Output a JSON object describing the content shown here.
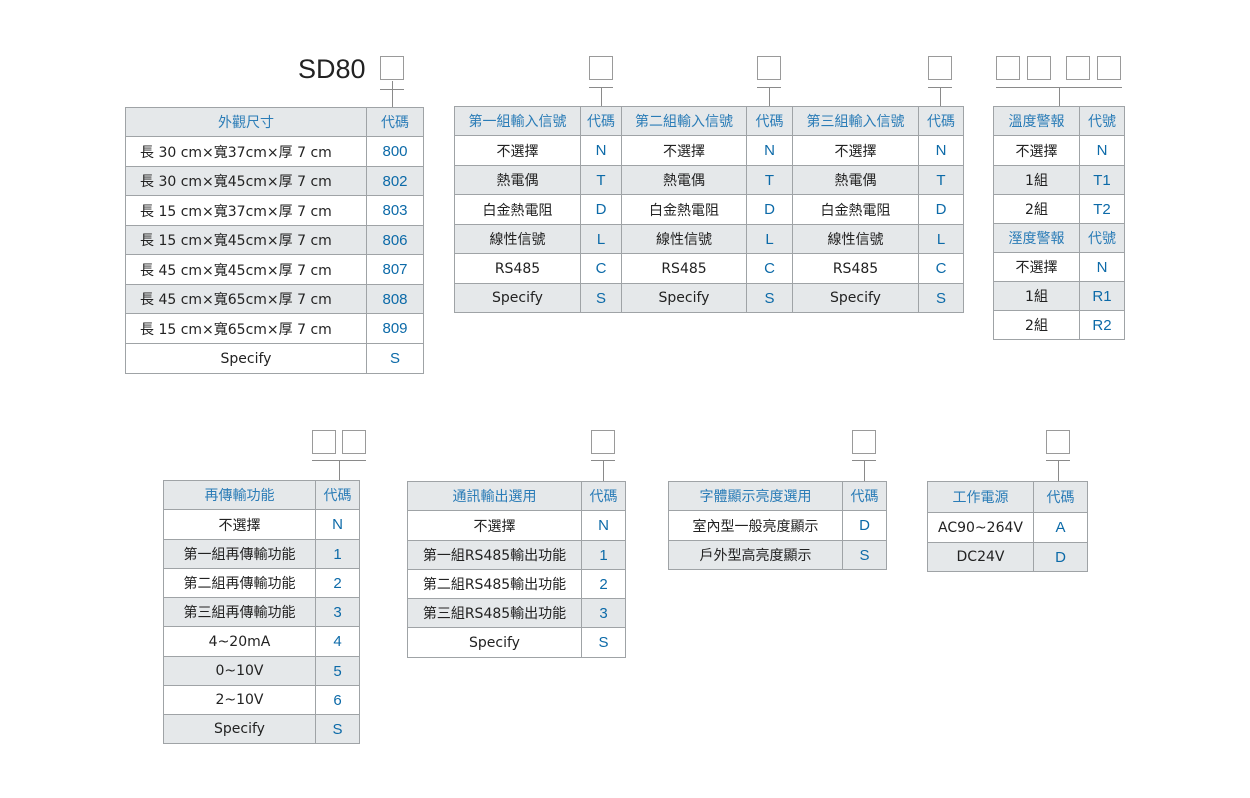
{
  "model": "SD80",
  "size_table": {
    "header": {
      "name": "外觀尺寸",
      "code": "代碼"
    },
    "rows": [
      {
        "name": "長 30 cm×寬37cm×厚 7 cm",
        "code": "800"
      },
      {
        "name": "長 30 cm×寬45cm×厚 7 cm",
        "code": "802"
      },
      {
        "name": "長 15 cm×寬37cm×厚 7 cm",
        "code": "803"
      },
      {
        "name": "長 15 cm×寬45cm×厚 7 cm",
        "code": "806"
      },
      {
        "name": "長 45 cm×寬45cm×厚 7 cm",
        "code": "807"
      },
      {
        "name": "長 45 cm×寬65cm×厚 7 cm",
        "code": "808"
      },
      {
        "name": "長 15 cm×寬65cm×厚 7 cm",
        "code": "809"
      },
      {
        "name": "Specify",
        "code": "S"
      }
    ]
  },
  "input_table": {
    "headers": [
      {
        "name": "第一組輸入信號",
        "code": "代碼"
      },
      {
        "name": "第二組輸入信號",
        "code": "代碼"
      },
      {
        "name": "第三組輸入信號",
        "code": "代碼"
      }
    ],
    "rows": [
      {
        "name": "不選擇",
        "code": "N"
      },
      {
        "name": "熱電偶",
        "code": "T"
      },
      {
        "name": "白金熱電阻",
        "code": "D"
      },
      {
        "name": "線性信號",
        "code": "L"
      },
      {
        "name": "RS485",
        "code": "C"
      },
      {
        "name": "Specify",
        "code": "S"
      }
    ]
  },
  "alarm_table": {
    "temp_header": {
      "name": "溫度警報",
      "code": "代號"
    },
    "temp_rows": [
      {
        "name": "不選擇",
        "code": "N"
      },
      {
        "name": "1組",
        "code": "T1"
      },
      {
        "name": "2組",
        "code": "T2"
      }
    ],
    "hum_header": {
      "name": "溼度警報",
      "code": "代號"
    },
    "hum_rows": [
      {
        "name": "不選擇",
        "code": "N"
      },
      {
        "name": "1組",
        "code": "R1"
      },
      {
        "name": "2組",
        "code": "R2"
      }
    ]
  },
  "retrans_table": {
    "header": {
      "name": "再傳輸功能",
      "code": "代碼"
    },
    "rows": [
      {
        "name": "不選擇",
        "code": "N"
      },
      {
        "name": "第一組再傳輸功能",
        "code": "1"
      },
      {
        "name": "第二組再傳輸功能",
        "code": "2"
      },
      {
        "name": "第三組再傳輸功能",
        "code": "3"
      },
      {
        "name": "4~20mA",
        "code": "4"
      },
      {
        "name": "0~10V",
        "code": "5"
      },
      {
        "name": "2~10V",
        "code": "6"
      },
      {
        "name": "Specify",
        "code": "S"
      }
    ]
  },
  "comm_table": {
    "header": {
      "name": "通訊輸出選用",
      "code": "代碼"
    },
    "rows": [
      {
        "name": "不選擇",
        "code": "N"
      },
      {
        "name": "第一組RS485輸出功能",
        "code": "1"
      },
      {
        "name": "第二組RS485輸出功能",
        "code": "2"
      },
      {
        "name": "第三組RS485輸出功能",
        "code": "3"
      },
      {
        "name": "Specify",
        "code": "S"
      }
    ]
  },
  "font_table": {
    "header": {
      "name": "字體顯示亮度選用",
      "code": "代碼"
    },
    "rows": [
      {
        "name": "室內型一般亮度顯示",
        "code": "D"
      },
      {
        "name": "戶外型高亮度顯示",
        "code": "S"
      }
    ]
  },
  "power_table": {
    "header": {
      "name": "工作電源",
      "code": "代碼"
    },
    "rows": [
      {
        "name": "AC90~264V",
        "code": "A"
      },
      {
        "name": "DC24V",
        "code": "D"
      }
    ]
  },
  "colors": {
    "header_text": "#2a7cb7",
    "code_text": "#0c6aa8",
    "shade": "#e5e8ea",
    "border": "#9fa3a6"
  }
}
